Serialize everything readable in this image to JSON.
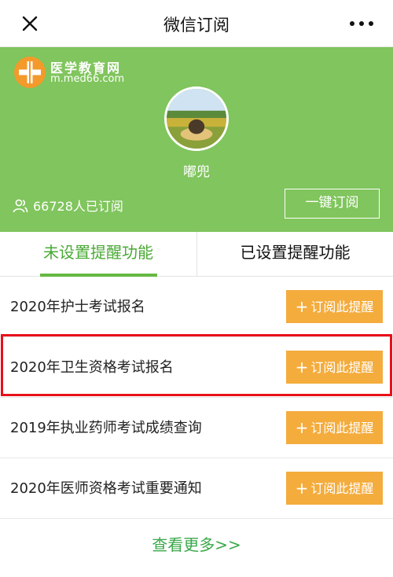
{
  "header": {
    "title": "微信订阅",
    "close_icon": "close-icon",
    "more_icon": "more-dots-icon"
  },
  "banner": {
    "background_color": "#80c55d",
    "logo": {
      "name": "医学教育网",
      "url": "m.med66.com",
      "color": "#f39a2b"
    },
    "nickname": "嘟兜",
    "subscriber_count": "66728人已订阅",
    "one_click_label": "一键订阅"
  },
  "tabs": [
    {
      "label": "未设置提醒功能",
      "active": true
    },
    {
      "label": "已设置提醒功能",
      "active": false
    }
  ],
  "items": [
    {
      "title": "2020年护士考试报名",
      "button": "订阅此提醒"
    },
    {
      "title": "2020年卫生资格考试报名",
      "button": "订阅此提醒",
      "highlighted": true
    },
    {
      "title": "2019年执业药师考试成绩查询",
      "button": "订阅此提醒"
    },
    {
      "title": "2020年医师资格考试重要通知",
      "button": "订阅此提醒"
    }
  ],
  "view_more": "查看更多>>",
  "colors": {
    "accent_green": "#4aa936",
    "button_orange": "#f4ac3d",
    "highlight_red": "#e8101a"
  }
}
